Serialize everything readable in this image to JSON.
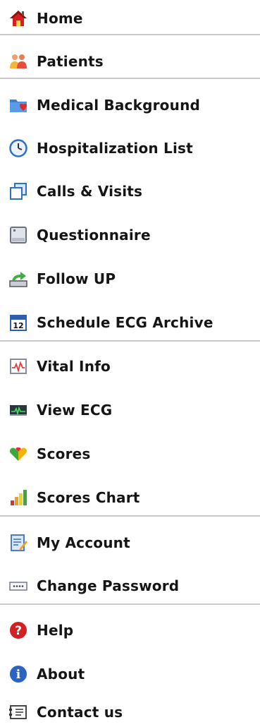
{
  "menu": {
    "items": [
      {
        "label": "Home",
        "icon": "home-icon"
      },
      {
        "label": "Patients",
        "icon": "patients-icon"
      },
      {
        "label": "Medical Background",
        "icon": "medical-folder-icon"
      },
      {
        "label": "Hospitalization List",
        "icon": "clock-icon"
      },
      {
        "label": "Calls & Visits",
        "icon": "pages-icon"
      },
      {
        "label": "Questionnaire",
        "icon": "notebook-icon"
      },
      {
        "label": "Follow UP",
        "icon": "follow-up-arrow-icon"
      },
      {
        "label": "Schedule ECG Archive",
        "icon": "calendar-icon"
      },
      {
        "label": "Vital Info",
        "icon": "vital-signs-icon"
      },
      {
        "label": "View ECG",
        "icon": "ecg-monitor-icon"
      },
      {
        "label": "Scores",
        "icon": "scores-hearts-icon"
      },
      {
        "label": "Scores Chart",
        "icon": "bar-chart-icon"
      },
      {
        "label": "My Account",
        "icon": "account-notebook-icon"
      },
      {
        "label": "Change Password",
        "icon": "password-field-icon"
      },
      {
        "label": "Help",
        "icon": "help-icon"
      },
      {
        "label": "About",
        "icon": "info-icon"
      },
      {
        "label": "Contact us",
        "icon": "contact-card-icon"
      }
    ]
  },
  "colors": {
    "text": "#151515",
    "divider": "#c9c9c9",
    "background": "#ffffff"
  }
}
